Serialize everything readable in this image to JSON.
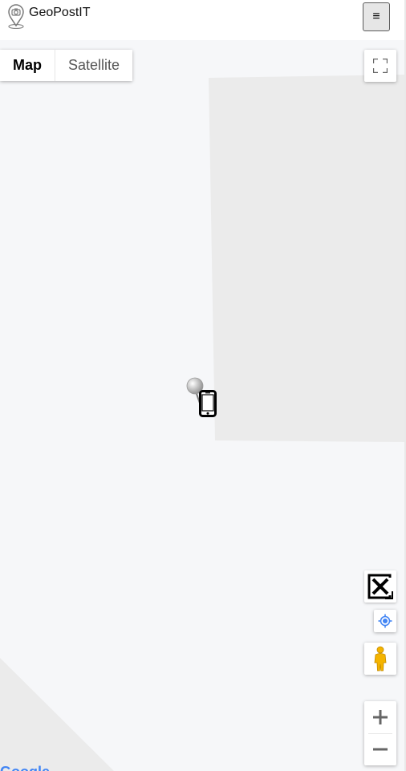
{
  "app": {
    "title": "GeoPostIT",
    "logo_icon": "camera-pin-icon",
    "menu_icon": "hamburger-menu-icon",
    "menu_label": "≡"
  },
  "map": {
    "type_control": {
      "map_label": "Map",
      "satellite_label": "Satellite",
      "selected": "Map"
    },
    "controls": {
      "fullscreen_icon": "fullscreen-icon",
      "close_icon": "close-box-icon",
      "locate_icon": "my-location-icon",
      "pegman_icon": "street-view-pegman-icon",
      "zoom_in_label": "+",
      "zoom_out_label": "−"
    },
    "markers": [
      {
        "icon": "gray-pushpin-icon"
      },
      {
        "icon": "mobile-phone-icon"
      }
    ],
    "attribution": "Google",
    "colors": {
      "background": "#f6f7f9",
      "area_fill": "#ebebeb",
      "pegman": "#f4b400",
      "locate": "#4285f4"
    }
  }
}
